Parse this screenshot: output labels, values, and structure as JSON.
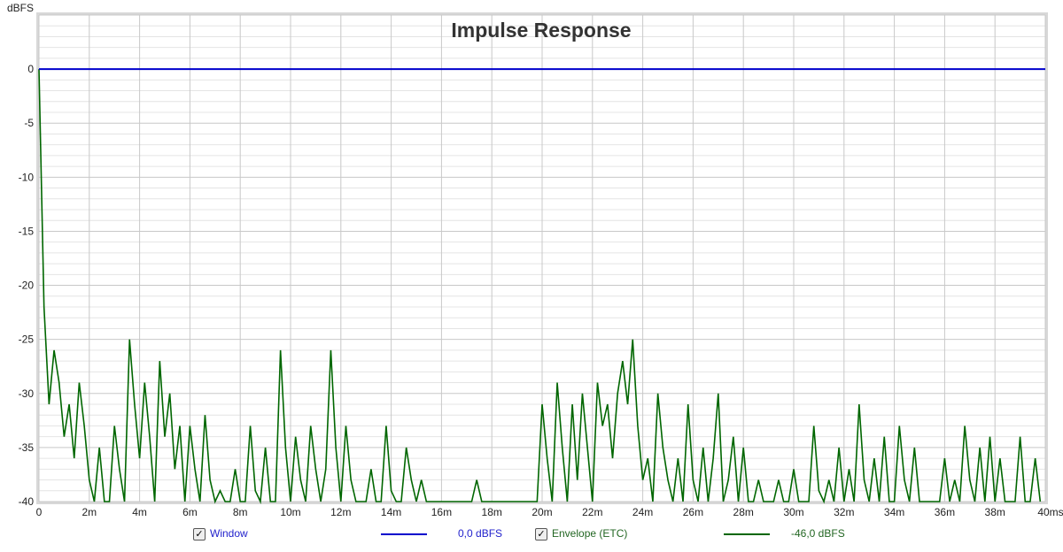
{
  "chart_data": {
    "type": "line",
    "title": "Impulse Response",
    "ylabel": "dBFS",
    "xlabel": "",
    "xlim": [
      0,
      40
    ],
    "ylim": [
      -40,
      5
    ],
    "x_ticks": [
      "0",
      "2m",
      "4m",
      "6m",
      "8m",
      "10m",
      "12m",
      "14m",
      "16m",
      "18m",
      "20m",
      "22m",
      "24m",
      "26m",
      "28m",
      "30m",
      "32m",
      "34m",
      "36m",
      "38m",
      "40ms"
    ],
    "y_ticks": [
      "0",
      "-5",
      "-10",
      "-15",
      "-20",
      "-25",
      "-30",
      "-35",
      "-40"
    ],
    "grid": true,
    "x_step_ms": 0.2,
    "series": [
      {
        "name": "Window",
        "value_label": "0,0 dBFS",
        "color": "#0000cc",
        "constant": 0
      },
      {
        "name": "Envelope (ETC)",
        "value_label": "-46,0 dBFS",
        "color": "#006600",
        "values": [
          0,
          -22,
          -31,
          -26,
          -29,
          -34,
          -31,
          -36,
          -29,
          -33,
          -38,
          -40,
          -35,
          -40,
          -40,
          -33,
          -37,
          -40,
          -25,
          -31,
          -36,
          -29,
          -34,
          -40,
          -27,
          -34,
          -30,
          -37,
          -33,
          -40,
          -33,
          -37,
          -40,
          -32,
          -38,
          -40,
          -39,
          -40,
          -40,
          -37,
          -40,
          -40,
          -33,
          -39,
          -40,
          -35,
          -40,
          -40,
          -26,
          -35,
          -40,
          -34,
          -38,
          -40,
          -33,
          -37,
          -40,
          -37,
          -26,
          -35,
          -40,
          -33,
          -38,
          -40,
          -40,
          -40,
          -37,
          -40,
          -40,
          -33,
          -39,
          -40,
          -40,
          -35,
          -38,
          -40,
          -38,
          -40,
          -40,
          -40,
          -40,
          -40,
          -40,
          -40,
          -40,
          -40,
          -40,
          -38,
          -40,
          -40,
          -40,
          -40,
          -40,
          -40,
          -40,
          -40,
          -40,
          -40,
          -40,
          -40,
          -31,
          -36,
          -40,
          -29,
          -35,
          -40,
          -31,
          -38,
          -30,
          -35,
          -40,
          -29,
          -33,
          -31,
          -36,
          -30,
          -27,
          -31,
          -25,
          -33,
          -38,
          -36,
          -40,
          -30,
          -35,
          -38,
          -40,
          -36,
          -40,
          -31,
          -38,
          -40,
          -35,
          -40,
          -36,
          -30,
          -40,
          -38,
          -34,
          -40,
          -35,
          -40,
          -40,
          -38,
          -40,
          -40,
          -40,
          -38,
          -40,
          -40,
          -37,
          -40,
          -40,
          -40,
          -33,
          -39,
          -40,
          -38,
          -40,
          -35,
          -40,
          -37,
          -40,
          -31,
          -38,
          -40,
          -36,
          -40,
          -34,
          -40,
          -40,
          -33,
          -38,
          -40,
          -35,
          -40,
          -40,
          -40,
          -40,
          -40,
          -36,
          -40,
          -38,
          -40,
          -33,
          -38,
          -40,
          -35,
          -40,
          -34,
          -40,
          -36,
          -40,
          -40,
          -40,
          -34,
          -40,
          -40,
          -36,
          -40
        ]
      }
    ]
  },
  "legend": {
    "window_checked": true,
    "envelope_checked": true,
    "check_glyph": "✓"
  }
}
